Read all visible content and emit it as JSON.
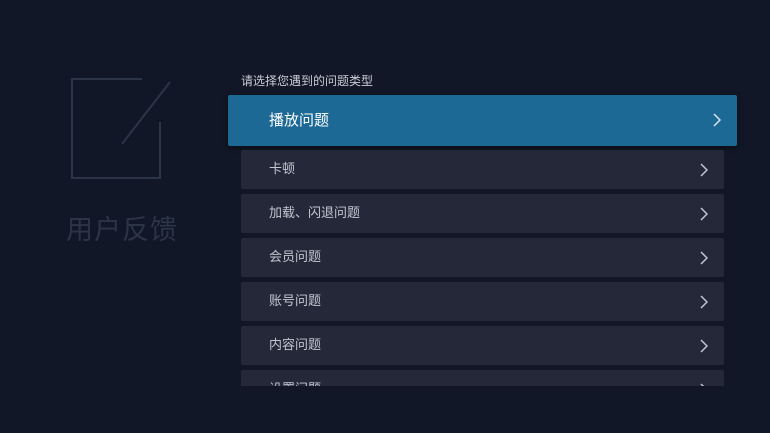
{
  "page": {
    "title": "用户反馈",
    "prompt": "请选择您遇到的问题类型"
  },
  "issues": {
    "items": [
      {
        "label": "播放问题",
        "focused": true
      },
      {
        "label": "卡顿"
      },
      {
        "label": "加载、闪退问题"
      },
      {
        "label": "会员问题"
      },
      {
        "label": "账号问题"
      },
      {
        "label": "内容问题"
      },
      {
        "label": "设置问题"
      }
    ]
  },
  "colors": {
    "background": "#111726",
    "item_background": "#242839",
    "focused_background": "#1d6996",
    "decor": "#2c3447"
  },
  "icons": {
    "feedback": "edit-square-icon",
    "item_arrow": "chevron-right-icon"
  }
}
